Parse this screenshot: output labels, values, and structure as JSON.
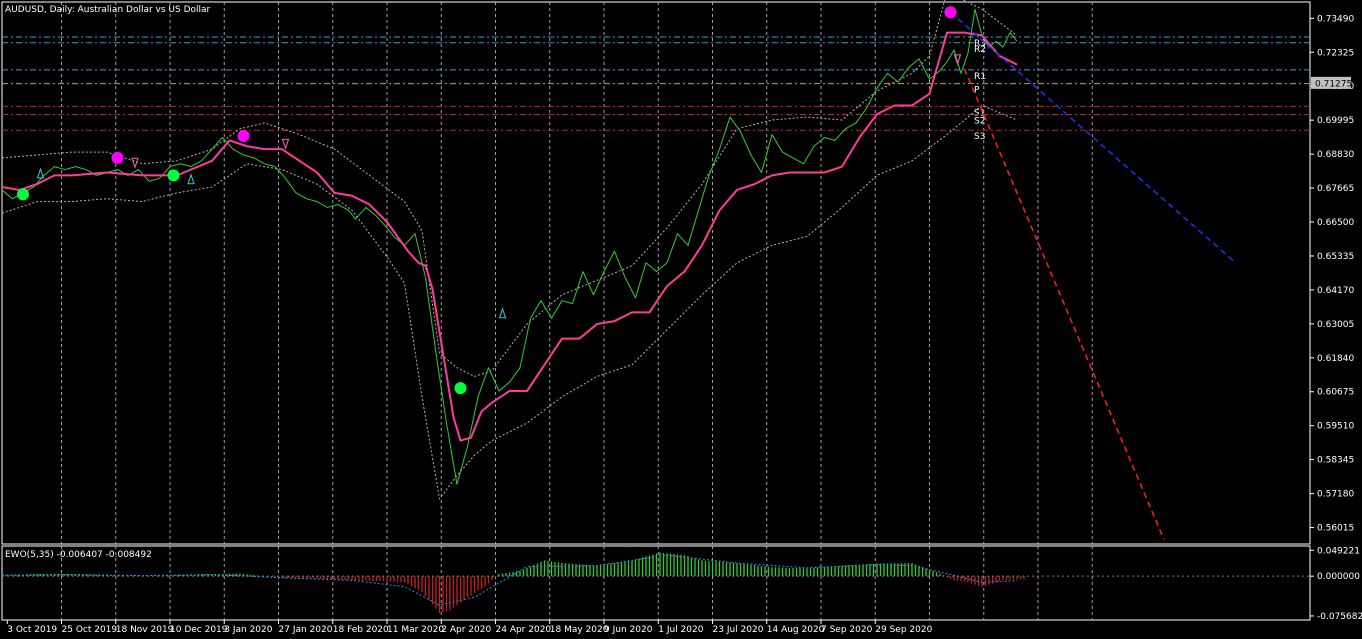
{
  "header": {
    "title": "AUDUSD, Daily:  Australian Dollar vs US Dollar",
    "current_price": "0.71275"
  },
  "colors": {
    "background": "#000000",
    "grid": "#c8c8c8",
    "price_line": "#32cd32",
    "mid_band": "#ff3c9b",
    "envelope": "#b4b4b4",
    "buy_dot": "#00ff3c",
    "sell_dot": "#ff00ff",
    "pivot_red": "#d21e1e",
    "pivot_blue": "#3c9bd2",
    "pivot_p": "#c8a050",
    "trend_blue": "#1e32ff",
    "trend_red": "#ff1e1e",
    "ewo_up": "#32cd32",
    "ewo_down": "#c81e1e",
    "ewo_signal": "#1e90ff",
    "price_badge_bg": "#c0c0c0"
  },
  "chart_data": [
    {
      "type": "line",
      "name": "AUDUSD Daily price",
      "xlabel": "",
      "ylabel": "",
      "grid": true,
      "ylim": [
        0.5545,
        0.7405
      ],
      "y_ticks": [
        0.7349,
        0.72325,
        0.7116,
        0.69995,
        0.6883,
        0.67665,
        0.665,
        0.65335,
        0.6417,
        0.63005,
        0.6184,
        0.60675,
        0.5951,
        0.58345,
        0.5718,
        0.56015
      ],
      "x_tick_labels": [
        "3 Oct 2019",
        "25 Oct 2019",
        "18 Nov 2019",
        "10 Dec 2019",
        "3 Jan 2020",
        "27 Jan 2020",
        "18 Feb 2020",
        "11 Mar 2020",
        "2 Apr 2020",
        "24 Apr 2020",
        "18 May 2020",
        "9 Jun 2020",
        "1 Jul 2020",
        "23 Jul 2020",
        "14 Aug 2020",
        "7 Sep 2020",
        "29 Sep 2020"
      ],
      "x_range_bars": [
        0,
        292
      ],
      "series": [
        {
          "name": "price",
          "x": [
            0,
            3,
            6,
            9,
            12,
            15,
            18,
            21,
            24,
            27,
            30,
            33,
            36,
            39,
            42,
            45,
            48,
            51,
            54,
            57,
            60,
            63,
            66,
            69,
            72,
            75,
            78,
            81,
            84,
            87,
            90,
            93,
            96,
            99,
            101,
            104,
            107,
            110,
            112,
            115,
            118,
            121,
            124,
            127,
            130,
            133,
            136,
            139,
            142,
            145,
            148,
            151,
            154,
            157,
            160,
            163,
            166,
            169,
            172,
            175,
            178,
            181,
            184,
            187,
            190,
            193,
            196,
            199,
            202,
            205,
            208,
            211,
            214,
            217,
            220,
            223,
            226,
            229,
            232,
            235,
            238,
            241,
            244,
            247,
            250,
            253,
            256,
            259,
            262,
            265,
            268,
            270,
            272,
            274,
            276,
            278,
            280,
            282,
            284,
            286,
            288,
            290
          ],
          "values": [
            0.676,
            0.673,
            0.675,
            0.677,
            0.681,
            0.684,
            0.683,
            0.684,
            0.683,
            0.681,
            0.682,
            0.683,
            0.681,
            0.683,
            0.679,
            0.68,
            0.684,
            0.685,
            0.684,
            0.686,
            0.69,
            0.694,
            0.69,
            0.688,
            0.687,
            0.685,
            0.684,
            0.68,
            0.675,
            0.673,
            0.672,
            0.67,
            0.671,
            0.669,
            0.666,
            0.67,
            0.667,
            0.663,
            0.66,
            0.657,
            0.661,
            0.646,
            0.62,
            0.596,
            0.575,
            0.588,
            0.605,
            0.615,
            0.607,
            0.61,
            0.615,
            0.632,
            0.638,
            0.632,
            0.638,
            0.637,
            0.648,
            0.64,
            0.648,
            0.655,
            0.646,
            0.639,
            0.651,
            0.648,
            0.651,
            0.661,
            0.657,
            0.669,
            0.681,
            0.69,
            0.701,
            0.696,
            0.688,
            0.682,
            0.695,
            0.689,
            0.687,
            0.685,
            0.691,
            0.694,
            0.693,
            0.697,
            0.699,
            0.704,
            0.711,
            0.716,
            0.713,
            0.718,
            0.721,
            0.714,
            0.717,
            0.72,
            0.724,
            0.716,
            0.723,
            0.738,
            0.729,
            0.725,
            0.727,
            0.725,
            0.73,
            0.727
          ]
        },
        {
          "name": "mid band",
          "x": [
            0,
            5,
            10,
            15,
            20,
            30,
            40,
            50,
            60,
            65,
            70,
            75,
            80,
            85,
            90,
            95,
            100,
            105,
            110,
            113,
            116,
            119,
            121,
            123,
            126,
            129,
            131,
            134,
            137,
            140,
            145,
            150,
            155,
            160,
            165,
            170,
            175,
            180,
            185,
            190,
            195,
            200,
            205,
            210,
            215,
            220,
            225,
            230,
            235,
            240,
            245,
            250,
            255,
            260,
            265,
            270,
            272,
            275,
            280,
            285,
            290
          ],
          "values": [
            0.677,
            0.676,
            0.678,
            0.681,
            0.681,
            0.682,
            0.681,
            0.681,
            0.686,
            0.693,
            0.691,
            0.69,
            0.69,
            0.686,
            0.682,
            0.675,
            0.674,
            0.671,
            0.665,
            0.66,
            0.655,
            0.651,
            0.65,
            0.642,
            0.62,
            0.598,
            0.59,
            0.591,
            0.6,
            0.603,
            0.607,
            0.607,
            0.616,
            0.625,
            0.625,
            0.63,
            0.631,
            0.634,
            0.634,
            0.643,
            0.648,
            0.657,
            0.669,
            0.676,
            0.678,
            0.681,
            0.682,
            0.682,
            0.682,
            0.684,
            0.694,
            0.702,
            0.705,
            0.705,
            0.709,
            0.73,
            0.73,
            0.73,
            0.729,
            0.722,
            0.719
          ]
        },
        {
          "name": "upper envelope",
          "x": [
            0,
            10,
            20,
            30,
            40,
            50,
            60,
            68,
            75,
            85,
            95,
            105,
            115,
            120,
            125,
            130,
            135,
            140,
            150,
            160,
            170,
            180,
            190,
            200,
            210,
            220,
            230,
            240,
            250,
            260,
            265,
            270,
            280,
            290
          ],
          "values": [
            0.687,
            0.688,
            0.689,
            0.689,
            0.685,
            0.686,
            0.69,
            0.697,
            0.699,
            0.695,
            0.69,
            0.681,
            0.672,
            0.662,
            0.62,
            0.615,
            0.612,
            0.614,
            0.63,
            0.64,
            0.645,
            0.65,
            0.663,
            0.678,
            0.697,
            0.7,
            0.701,
            0.7,
            0.71,
            0.716,
            0.722,
            0.744,
            0.738,
            0.729
          ]
        },
        {
          "name": "lower envelope",
          "x": [
            0,
            10,
            20,
            30,
            40,
            50,
            60,
            70,
            80,
            90,
            100,
            110,
            115,
            120,
            125,
            130,
            135,
            140,
            150,
            160,
            170,
            180,
            190,
            200,
            210,
            220,
            230,
            240,
            250,
            260,
            270,
            280,
            290
          ],
          "values": [
            0.668,
            0.672,
            0.672,
            0.673,
            0.672,
            0.675,
            0.677,
            0.685,
            0.683,
            0.678,
            0.669,
            0.653,
            0.644,
            0.605,
            0.57,
            0.578,
            0.585,
            0.59,
            0.596,
            0.605,
            0.612,
            0.616,
            0.628,
            0.64,
            0.651,
            0.657,
            0.66,
            0.67,
            0.681,
            0.686,
            0.695,
            0.705,
            0.7
          ]
        }
      ],
      "markers": {
        "buy_dots": [
          {
            "x": 6,
            "y": 0.6745
          },
          {
            "x": 49,
            "y": 0.681
          },
          {
            "x": 131,
            "y": 0.608
          }
        ],
        "sell_dots": [
          {
            "x": 33,
            "y": 0.687
          },
          {
            "x": 69,
            "y": 0.6945
          },
          {
            "x": 271,
            "y": 0.737
          }
        ],
        "cyan_arrows": [
          {
            "x": 11,
            "y": 0.6815
          },
          {
            "x": 54,
            "y": 0.6795
          },
          {
            "x": 143,
            "y": 0.6335
          }
        ],
        "magenta_arrows": [
          {
            "x": 38,
            "y": 0.6855
          },
          {
            "x": 81,
            "y": 0.692
          },
          {
            "x": 273,
            "y": 0.721
          }
        ]
      },
      "pivot_levels": [
        {
          "label": "R3",
          "value": 0.7285,
          "color": "#3c9bd2"
        },
        {
          "label": "R2",
          "value": 0.7265,
          "color": "#3c9bd2"
        },
        {
          "label": "R1",
          "value": 0.7172,
          "color": "#3c9bd2"
        },
        {
          "label": "P",
          "value": 0.7125,
          "color": "#c8a050"
        },
        {
          "label": "S1",
          "value": 0.7047,
          "color": "#d21e1e"
        },
        {
          "label": "S2",
          "value": 0.7019,
          "color": "#d21e1e"
        },
        {
          "label": "S3",
          "value": 0.6965,
          "color": "#d21e1e"
        }
      ],
      "trendlines": [
        {
          "name": "blue",
          "x1": 271,
          "y1": 0.737,
          "x2": 352,
          "y2": 0.6515,
          "color": "#1e32ff"
        },
        {
          "name": "red",
          "x1": 275,
          "y1": 0.7175,
          "x2": 332,
          "y2": 0.556,
          "color": "#ff1e1e"
        }
      ]
    },
    {
      "type": "bar",
      "name": "EWO(5,35)",
      "title": "EWO(5,35) -0.006407 -0.008492",
      "ylim": [
        -0.0815,
        0.0555
      ],
      "y_ticks": [
        0.049221,
        0.0,
        -0.075682
      ],
      "histogram": {
        "x": [
          0,
          10,
          20,
          30,
          40,
          50,
          60,
          68,
          80,
          90,
          100,
          110,
          115,
          120,
          125,
          128,
          133,
          138,
          142,
          148,
          155,
          160,
          170,
          180,
          188,
          195,
          200,
          210,
          220,
          230,
          240,
          250,
          260,
          268,
          272,
          276,
          280,
          286,
          290
        ],
        "values": [
          0.001,
          0.004,
          0.004,
          0.002,
          -0.001,
          0.002,
          0.004,
          0.005,
          -0.004,
          -0.005,
          -0.008,
          -0.01,
          -0.012,
          -0.03,
          -0.07,
          -0.065,
          -0.04,
          -0.02,
          0.004,
          0.01,
          0.03,
          0.025,
          0.02,
          0.03,
          0.045,
          0.04,
          0.03,
          0.025,
          0.017,
          0.015,
          0.02,
          0.024,
          0.025,
          0.005,
          -0.008,
          -0.012,
          -0.02,
          -0.008,
          -0.006
        ]
      },
      "signal": {
        "x": [
          0,
          20,
          40,
          60,
          80,
          100,
          115,
          125,
          135,
          150,
          170,
          190,
          210,
          230,
          250,
          260,
          270,
          280,
          290
        ],
        "values": [
          0.002,
          0.003,
          0.001,
          0.003,
          -0.003,
          -0.008,
          -0.02,
          -0.055,
          -0.04,
          0.018,
          0.02,
          0.04,
          0.025,
          0.016,
          0.022,
          0.02,
          0.005,
          -0.012,
          -0.0085
        ]
      }
    }
  ]
}
